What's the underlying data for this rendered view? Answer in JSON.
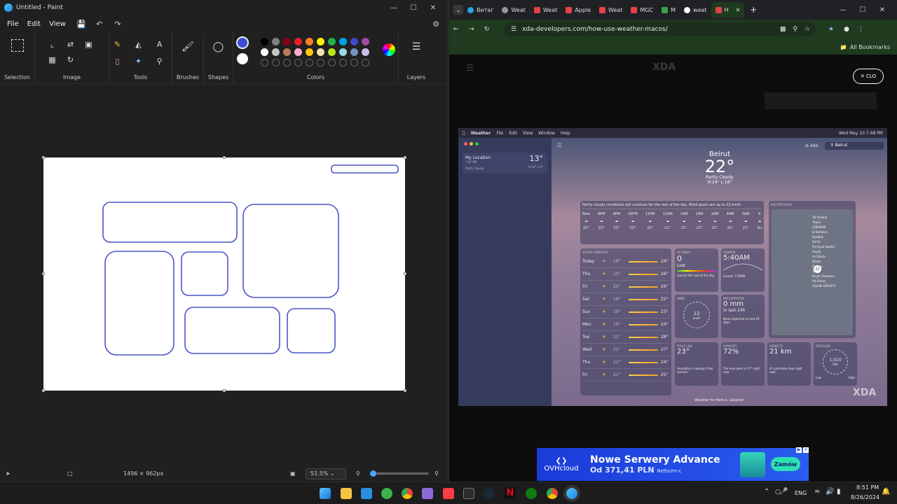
{
  "paint": {
    "window_title": "Untitled - Paint",
    "menu": [
      "File",
      "Edit",
      "View"
    ],
    "groups": {
      "selection": "Selection",
      "image": "Image",
      "tools": "Tools",
      "brushes": "Brushes",
      "shapes": "Shapes",
      "colors": "Colors",
      "layers": "Layers"
    },
    "active_color": "#3b4bd4",
    "secondary_color": "#ffffff",
    "palette": [
      "#000000",
      "#7f7f7f",
      "#880015",
      "#ed1c24",
      "#ff7f27",
      "#fff200",
      "#22b14c",
      "#00a2e8",
      "#3f48cc",
      "#a349a4",
      "#ffffff",
      "#c3c3c3",
      "#b97a57",
      "#ffaec9",
      "#ffc90e",
      "#efe4b0",
      "#b5e61d",
      "#99d9ea",
      "#7092be",
      "#c8bfe7"
    ],
    "status": {
      "dimensions": "1496 × 962px",
      "zoom": "51.5%",
      "zoom_level": 0.05
    }
  },
  "browser": {
    "tabs": [
      "Витаг",
      "Weat",
      "Weat",
      "Apple",
      "Weat",
      "MGC",
      "M",
      "weat",
      "H"
    ],
    "url": "xda-developers.com/how-use-weather-macos/",
    "bookmarks_label": "All Bookmarks",
    "close_label": "CLO",
    "brand": "XDA",
    "mac": {
      "menu": [
        "Weather",
        "File",
        "Edit",
        "View",
        "Window",
        "Help"
      ],
      "clock": "Wed May 10 7:48 PM",
      "search_value": "Beirut",
      "add_label": "Add",
      "sidebar_item": {
        "title": "My Location",
        "time": "7:47 PM",
        "temp": "13°",
        "cond": "Partly Cloudy",
        "hl": "H:16° L:9°"
      },
      "city": "Beirut",
      "temp": "22°",
      "condition": "Partly Cloudy",
      "hilo": "H:24° L:18°",
      "summary": "Partly cloudy conditions will continue for the rest of the day. Wind gusts are up to 22 km/h.",
      "hourly_times": [
        "Now",
        "8PM",
        "9PM",
        "10PM",
        "11PM",
        "12AM",
        "1AM",
        "2AM",
        "3AM",
        "4AM",
        "5AM",
        "6"
      ],
      "hourly_temps": [
        "22°",
        "22°",
        "22°",
        "22°",
        "22°",
        "21°",
        "21°",
        "21°",
        "21°",
        "21°",
        "21°",
        "Su"
      ],
      "forecast_label": "10-DAY FORECAST",
      "forecast": [
        {
          "day": "Today",
          "lo": "18°",
          "hi": "24°"
        },
        {
          "day": "Thu",
          "lo": "20°",
          "hi": "26°"
        },
        {
          "day": "Fri",
          "lo": "20°",
          "hi": "26°"
        },
        {
          "day": "Sat",
          "lo": "18°",
          "hi": "22°"
        },
        {
          "day": "Sun",
          "lo": "18°",
          "hi": "23°"
        },
        {
          "day": "Mon",
          "lo": "19°",
          "hi": "24°"
        },
        {
          "day": "Tue",
          "lo": "21°",
          "hi": "28°"
        },
        {
          "day": "Wed",
          "lo": "22°",
          "hi": "27°"
        },
        {
          "day": "Thu",
          "lo": "21°",
          "hi": "24°"
        },
        {
          "day": "Fri",
          "lo": "21°",
          "hi": "25°"
        }
      ],
      "uv": {
        "label": "UV INDEX",
        "value": "0",
        "sub": "Low",
        "note": "Low for the rest of the day."
      },
      "sunrise": {
        "label": "SUNRISE",
        "value": "5:40AM",
        "note": "Sunset: 7:29PM"
      },
      "wind": {
        "label": "WIND",
        "value": "12",
        "unit": "km/h"
      },
      "precip": {
        "label": "PRECIPITATION",
        "value": "0 mm",
        "sub": "in last 24h",
        "note": "None expected in next 10 days."
      },
      "feels": {
        "label": "FEELS LIKE",
        "value": "23°",
        "note": "Humidity is making it feel warmer."
      },
      "humidity": {
        "label": "HUMIDITY",
        "value": "72%",
        "note": "The dew point is 17° right now."
      },
      "visibility": {
        "label": "VISIBILITY",
        "value": "21 km",
        "note": "It's perfectly clear right now."
      },
      "pressure": {
        "label": "PRESSURE",
        "value": "1,010",
        "unit": "hPa",
        "low": "Low",
        "high": "High"
      },
      "map_label": "PRECIPITATION",
      "map_places": [
        "Tall Kalakh",
        "Tripoli",
        "LEBANON",
        "El Bahbara",
        "Baalbek",
        "Zahlé",
        "Ra'Ayyat Sawfar",
        "Sayda",
        "Az Zabda",
        "Dibbin",
        "Qatana",
        "Tyr",
        "Kiryat Shemona",
        "Ad Dimas",
        "GOLAN HEIGHTS"
      ],
      "map_marker": "22",
      "footer": "Weather for Beirut, Lebanon"
    },
    "ad": {
      "brand": "OVHcloud",
      "headline": "Nowe Serwery Advance",
      "price": "Od 371,41 PLN",
      "price_note": "Netto/m-c",
      "cta": "Zamów"
    }
  },
  "taskbar": {
    "lang": "ENG",
    "time": "8:51 PM",
    "date": "8/26/2024"
  }
}
